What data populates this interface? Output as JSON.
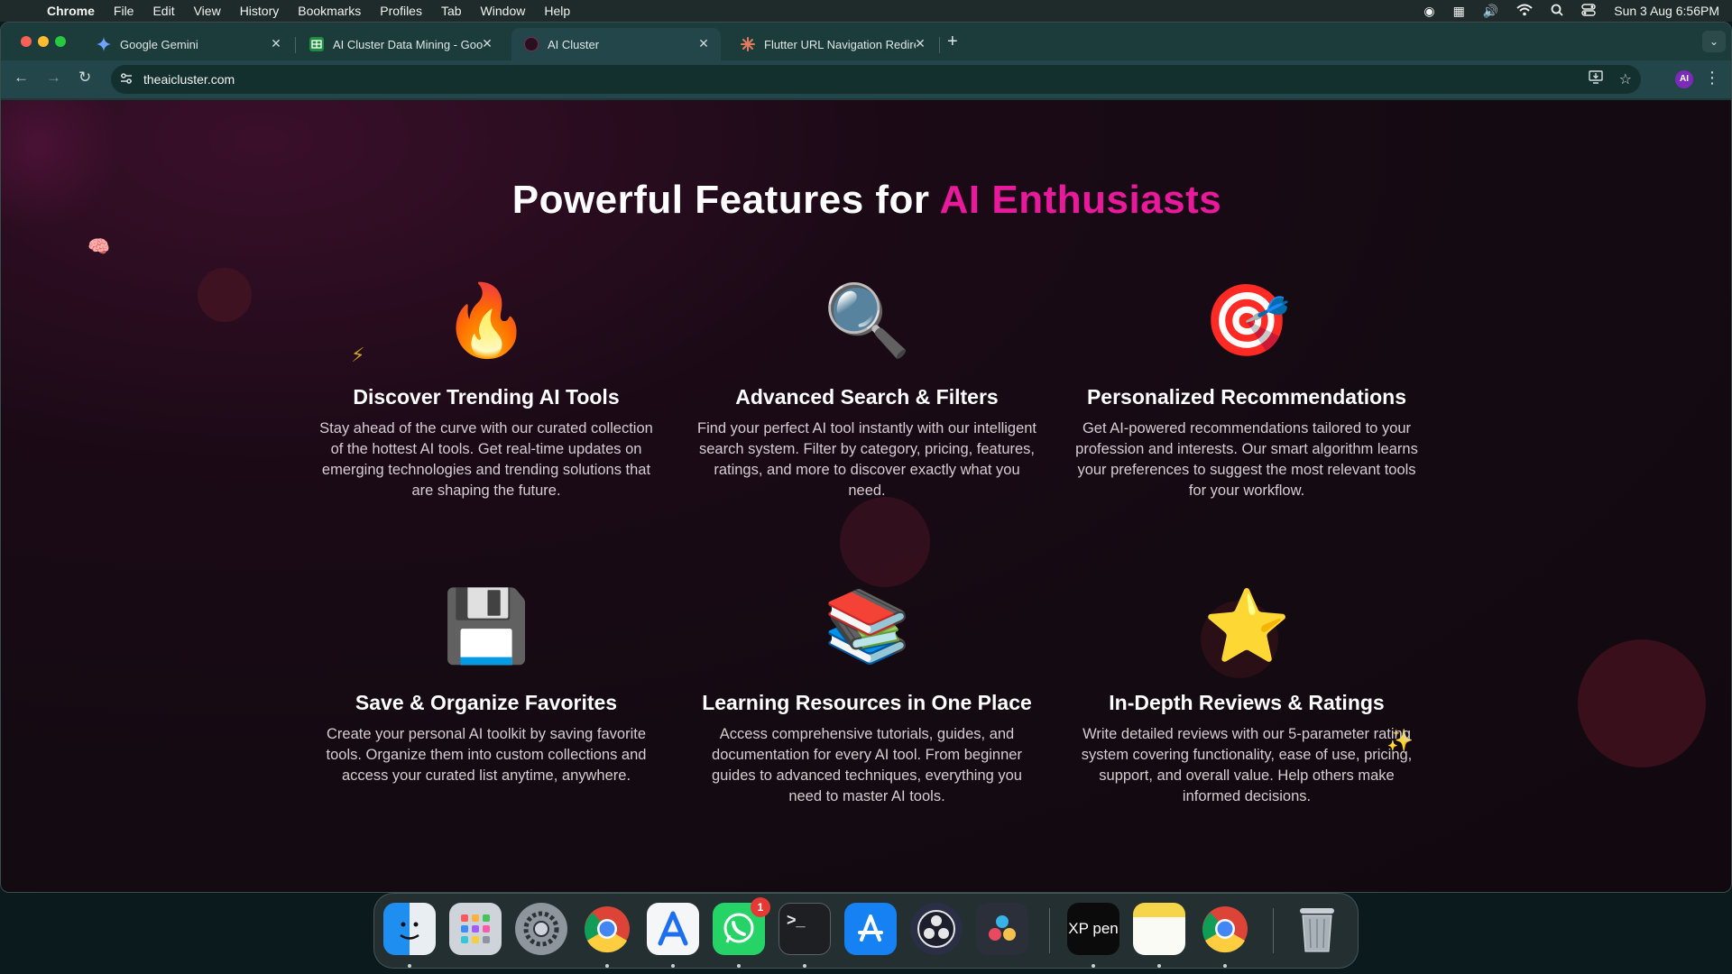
{
  "menubar": {
    "app": "Chrome",
    "items": [
      "File",
      "Edit",
      "View",
      "History",
      "Bookmarks",
      "Profiles",
      "Tab",
      "Window",
      "Help"
    ],
    "datetime": "Sun 3 Aug  6:56PM"
  },
  "tabs": [
    {
      "title": "Google Gemini",
      "favicon": "gemini-icon",
      "active": false
    },
    {
      "title": "AI Cluster Data Mining - Goog",
      "favicon": "sheets-icon",
      "active": false
    },
    {
      "title": "AI Cluster",
      "favicon": "aicluster-icon",
      "active": true
    },
    {
      "title": "Flutter URL Navigation Redire",
      "favicon": "claude-icon",
      "active": false
    }
  ],
  "toolbar": {
    "url": "theaicluster.com",
    "profile_initials": "AI"
  },
  "page": {
    "headline_main": "Powerful Features for ",
    "headline_accent": "AI Enthusiasts",
    "accent_color": "#e8199a",
    "features": [
      {
        "icon": "🔥",
        "icon_name": "fire-icon",
        "title": "Discover Trending AI Tools",
        "description": "Stay ahead of the curve with our curated collection of the hottest AI tools. Get real-time updates on emerging technologies and trending solutions that are shaping the future."
      },
      {
        "icon": "🔍",
        "icon_name": "magnifier-icon",
        "title": "Advanced Search & Filters",
        "description": "Find your perfect AI tool instantly with our intelligent search system. Filter by category, pricing, features, ratings, and more to discover exactly what you need."
      },
      {
        "icon": "🎯",
        "icon_name": "target-icon",
        "title": "Personalized Recommendations",
        "description": "Get AI-powered recommendations tailored to your profession and interests. Our smart algorithm learns your preferences to suggest the most relevant tools for your workflow."
      },
      {
        "icon": "💾",
        "icon_name": "floppy-disk-icon",
        "title": "Save & Organize Favorites",
        "description": "Create your personal AI toolkit by saving favorite tools. Organize them into custom collections and access your curated list anytime, anywhere."
      },
      {
        "icon": "📚",
        "icon_name": "books-icon",
        "title": "Learning Resources in One Place",
        "description": "Access comprehensive tutorials, guides, and documentation for every AI tool. From beginner guides to advanced techniques, everything you need to master AI tools."
      },
      {
        "icon": "⭐",
        "icon_name": "star-icon",
        "title": "In-Depth Reviews & Ratings",
        "description": "Write detailed reviews with our 5-parameter rating system covering functionality, ease of use, pricing, support, and overall value. Help others make informed decisions."
      }
    ]
  },
  "dock": {
    "apps": [
      "finder-icon",
      "launchpad-icon",
      "system-settings-icon",
      "chrome-icon",
      "xcode-instruments-icon",
      "whatsapp-icon",
      "terminal-icon",
      "app-store-icon",
      "obs-icon",
      "davinci-resolve-icon",
      "xppen-icon",
      "notes-icon",
      "chrome-icon",
      "trash-icon"
    ],
    "whatsapp_badge": "1",
    "xppen_label": "XP pen"
  }
}
